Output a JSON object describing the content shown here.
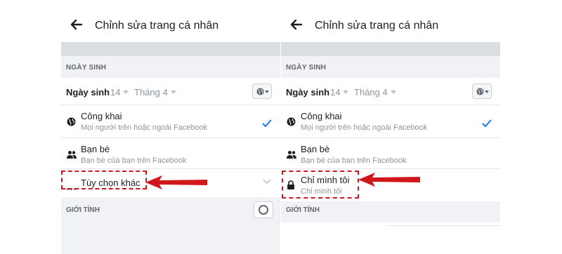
{
  "header": {
    "title": "Chỉnh sửa trang cá nhân"
  },
  "birthday_section": {
    "label": "NGÀY SINH",
    "field_label": "Ngày sinh",
    "day": "14",
    "month": "Tháng 4"
  },
  "options": {
    "public": {
      "title": "Công khai",
      "subtitle": "Mọi người trên hoặc ngoài Facebook"
    },
    "friends": {
      "title": "Bạn bè",
      "subtitle": "Bạn bè của bạn trên Facebook"
    },
    "more": {
      "title": "Tùy chọn khác"
    },
    "only_me": {
      "title": "Chỉ mình tôi",
      "subtitle": "Chỉ mình tôi"
    }
  },
  "gender_section": {
    "label": "GIỚI TÍNH"
  },
  "colors": {
    "accent": "#1877f2",
    "highlight": "#d0181c"
  },
  "icons": [
    "back-arrow-icon",
    "globe-icon",
    "friends-icon",
    "more-dots-icon",
    "lock-icon",
    "checkmark-icon",
    "chevron-down-icon",
    "radio-icon"
  ]
}
